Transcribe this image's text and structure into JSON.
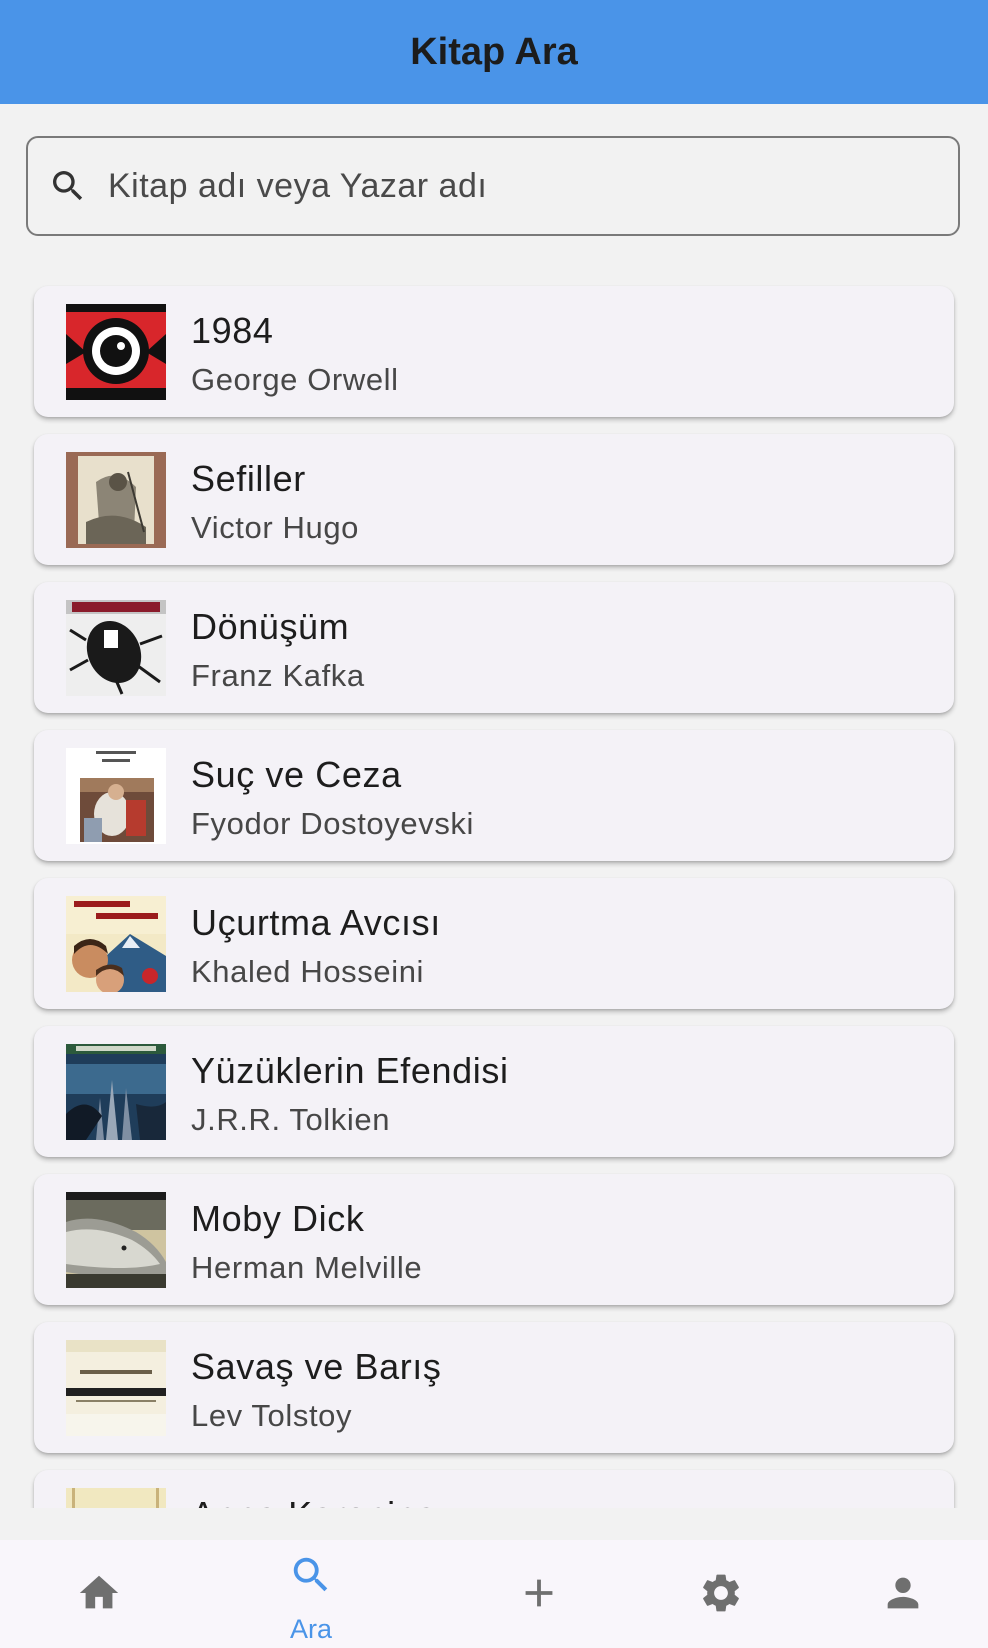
{
  "app_bar": {
    "title": "Kitap Ara"
  },
  "search": {
    "placeholder": "Kitap adı veya Yazar adı",
    "value": ""
  },
  "books": [
    {
      "title": "1984",
      "author": "George Orwell"
    },
    {
      "title": "Sefiller",
      "author": "Victor Hugo"
    },
    {
      "title": "Dönüşüm",
      "author": "Franz Kafka"
    },
    {
      "title": "Suç ve Ceza",
      "author": "Fyodor Dostoyevski"
    },
    {
      "title": "Uçurtma Avcısı",
      "author": "Khaled Hosseini"
    },
    {
      "title": "Yüzüklerin Efendisi",
      "author": "J.R.R. Tolkien"
    },
    {
      "title": "Moby Dick",
      "author": "Herman Melville"
    },
    {
      "title": "Savaş ve Barış",
      "author": "Lev Tolstoy"
    },
    {
      "title": "Anna Karenina",
      "author": ""
    }
  ],
  "bottom_nav": {
    "items": [
      {
        "icon": "home-icon",
        "label": ""
      },
      {
        "icon": "search-icon",
        "label": "Ara",
        "active": true
      },
      {
        "icon": "add-icon",
        "label": ""
      },
      {
        "icon": "settings-icon",
        "label": ""
      },
      {
        "icon": "person-icon",
        "label": ""
      }
    ]
  },
  "colors": {
    "accent": "#4a94e8",
    "background": "#f2f2f2",
    "card": "#f4f2f7",
    "inactive_icon": "#6f6f6f"
  }
}
